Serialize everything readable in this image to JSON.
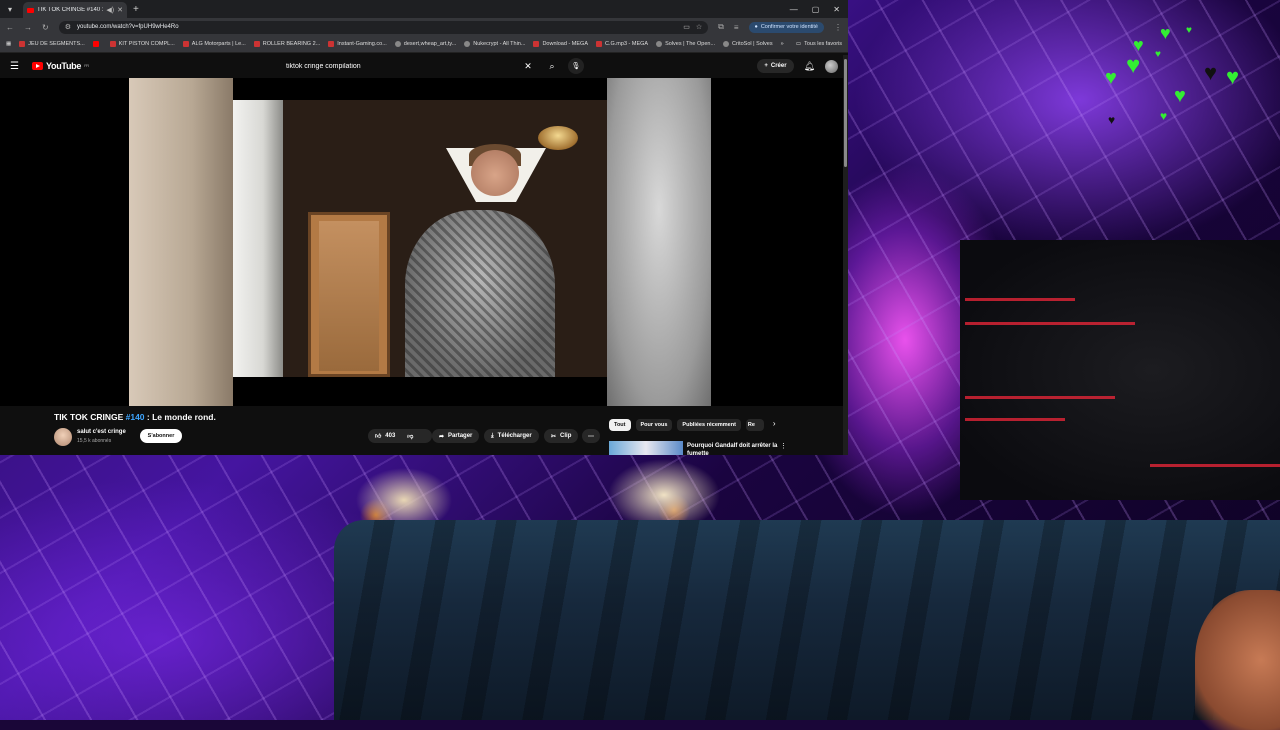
{
  "browser": {
    "tab_title": "TIK TOK CRINGE #140 : Le",
    "url": "youtube.com/watch?v=fpUH9wHe4Ro",
    "confirm_label": "Confirmer votre identité",
    "bookmarks": [
      "JEU DE SEGMENTS...",
      "",
      "KIT PISTON COMPL...",
      "ALG Motorparts | Le...",
      "ROLLER BEARING 2...",
      "Instant-Gaming.co...",
      "desert,wheap_art,ty...",
      "Nukecrypt - All Thin...",
      "Download - MEGA",
      "C.G.mp3 - MEGA",
      "Solves | The Open...",
      "CritoSol | Solves"
    ],
    "bookmarks_more": "»",
    "bookmarks_all": "Tous les favoris"
  },
  "youtube": {
    "logo_text": "YouTube",
    "logo_sup": "FR",
    "search_value": "tiktok cringe compilation",
    "create_label": "Créer",
    "video": {
      "title_prefix": "TIK TOK CRINGE ",
      "title_hashtag": "#140",
      "title_suffix": " : Le monde rond.",
      "channel_name": "salut c'est cringe",
      "subscribers": "15,5 k abonnés",
      "subscribe_label": "S'abonner",
      "likes": "403",
      "share_label": "Partager",
      "download_label": "Télécharger",
      "clip_label": "Clip"
    },
    "chips": [
      "Tout",
      "Pour vous",
      "Publiées récemment",
      "Re"
    ],
    "recommendation": {
      "title": "Pourquoi Gandalf doit arrêter la fumette"
    }
  }
}
